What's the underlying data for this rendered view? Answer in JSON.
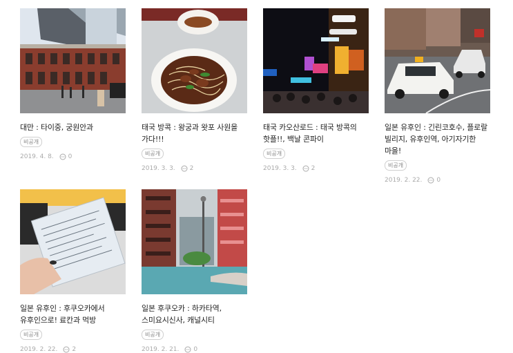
{
  "posts": [
    {
      "title": "대만 : 타이중, 궁원안과",
      "badge": "비공개",
      "date": "2019. 4. 8.",
      "comments": "0",
      "thumb_icon": "taichung-building-photo"
    },
    {
      "title": "태국 방콕 : 왕궁과 왓포 사원을 가다!!!",
      "badge": "비공개",
      "date": "2019. 3. 3.",
      "comments": "2",
      "thumb_icon": "noodle-soup-photo"
    },
    {
      "title": "태국 카오산로드 : 태국 방콕의 핫플!!, 백날 콘파이",
      "badge": "비공개",
      "date": "2019. 3. 3.",
      "comments": "2",
      "thumb_icon": "khaosan-night-street-photo"
    },
    {
      "title": "일본 유후인 : 긴린코호수, 플로랄 빌리지, 유후인역, 아기자기한 마을!",
      "badge": "비공개",
      "date": "2019. 2. 22.",
      "comments": "0",
      "thumb_icon": "yufuin-street-taxi-photo"
    },
    {
      "title": "일본 유후인 : 후쿠오카에서 유후인으로! 료칸과 먹방",
      "badge": "비공개",
      "date": "2019. 2. 22.",
      "comments": "2",
      "thumb_icon": "train-tickets-photo"
    },
    {
      "title": "일본 후쿠오카 : 하카타역, 스미요시신사, 캐널시티",
      "badge": "비공개",
      "date": "2019. 2. 21.",
      "comments": "0",
      "thumb_icon": "canal-city-photo"
    }
  ],
  "colors": {
    "title": "#222222",
    "meta": "#aaaaaa",
    "badge_border": "#cfcfcf"
  }
}
